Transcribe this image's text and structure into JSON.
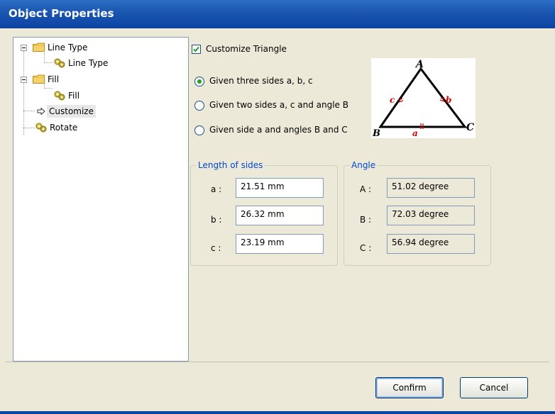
{
  "window": {
    "title": "Object Properties"
  },
  "tree": {
    "items": [
      {
        "label": "Line Type",
        "kind": "folder"
      },
      {
        "label": "Line Type",
        "kind": "leaf"
      },
      {
        "label": "Fill",
        "kind": "folder"
      },
      {
        "label": "Fill",
        "kind": "leaf"
      },
      {
        "label": "Customize",
        "kind": "leaf",
        "selected": true
      },
      {
        "label": "Rotate",
        "kind": "leaf"
      }
    ]
  },
  "customize": {
    "checkbox_label": "Customize Triangle",
    "checked": true
  },
  "mode": {
    "options": [
      "Given three sides a, b, c",
      "Given two sides a, c and angle B",
      "Given side a and angles B and C"
    ],
    "selected_index": 0
  },
  "diagram": {
    "vertex_A": "A",
    "vertex_B": "B",
    "vertex_C": "C",
    "side_a": "a",
    "side_b": "b",
    "side_c": "c"
  },
  "sides": {
    "group_title": "Length of sides",
    "a_label": "a :",
    "a_value": "21.51 mm",
    "b_label": "b :",
    "b_value": "26.32 mm",
    "c_label": "c :",
    "c_value": "23.19 mm"
  },
  "angles": {
    "group_title": "Angle",
    "A_label": "A :",
    "A_value": "51.02 degree",
    "B_label": "B :",
    "B_value": "72.03 degree",
    "C_label": "C :",
    "C_value": "56.94 degree"
  },
  "buttons": {
    "confirm": "Confirm",
    "cancel": "Cancel"
  },
  "colors": {
    "title_bar": "#0b43a3",
    "accent": "#0046d5",
    "triangle_marks": "#d00000"
  }
}
